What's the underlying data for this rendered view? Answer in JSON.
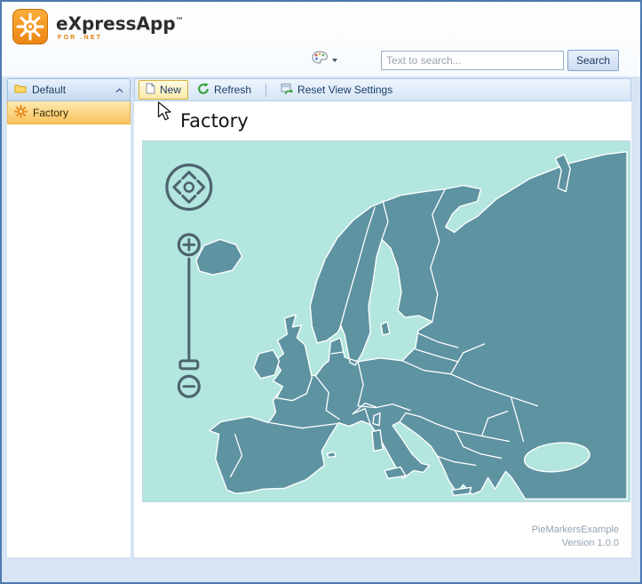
{
  "app": {
    "logo_text": "eXpressApp",
    "logo_tm": "™",
    "logo_tagline": "FOR .NET"
  },
  "topbar": {
    "search_placeholder": "Text to search...",
    "search_button": "Search"
  },
  "sidebar": {
    "group_label": "Default",
    "items": [
      {
        "label": "Factory",
        "selected": true
      }
    ]
  },
  "toolbar": {
    "new": "New",
    "refresh": "Refresh",
    "reset": "Reset View Settings"
  },
  "content": {
    "title": "Factory"
  },
  "map": {
    "region": "Europe",
    "sea_color": "#b2e6df",
    "land_color": "#5e93a1",
    "country_border_color": "#ffffff",
    "controls_color": "#4d646e",
    "controls": [
      "pan",
      "zoom-in",
      "zoom-slider",
      "zoom-out"
    ]
  },
  "footer": {
    "app_name": "PieMarkersExample",
    "version": "Version 1.0.0"
  },
  "icons": {
    "logo": "gear-sun-icon",
    "theme": "palette-icon",
    "theme_caret": "chevron-down-icon",
    "group": "folder-icon",
    "group_collapse": "chevron-up-icon",
    "factory": "gear-icon",
    "new": "new-document-icon",
    "refresh": "refresh-arrows-icon",
    "reset": "reset-view-icon",
    "map_pan": "pan-compass-icon",
    "map_zoom_in": "plus-icon",
    "map_zoom_out": "minus-icon",
    "cursor": "mouse-pointer-icon"
  },
  "colors": {
    "window_border": "#4e7ab0",
    "page_bg": "#d6e4f3",
    "selection_orange": "#f9c25c",
    "accent_orange": "#ee8f1e"
  }
}
